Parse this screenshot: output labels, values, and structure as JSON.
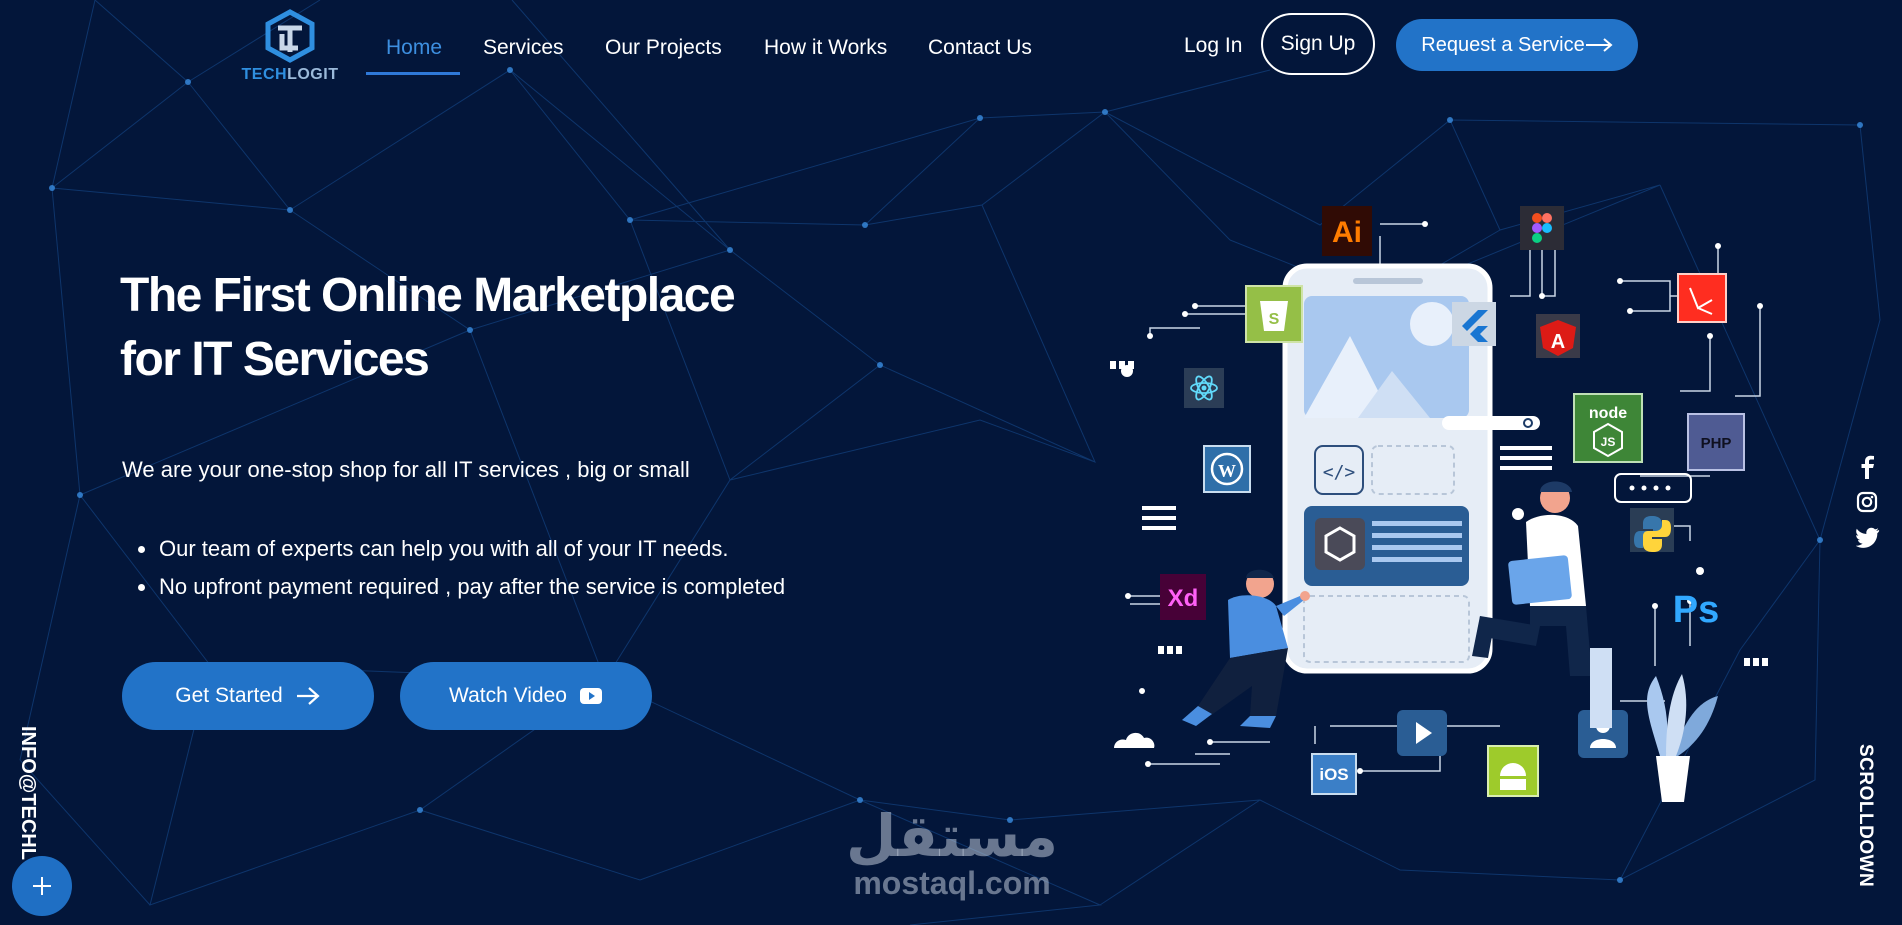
{
  "brand": {
    "logo_text_a": "TECH",
    "logo_text_b": "LOGIT"
  },
  "nav": {
    "links": [
      {
        "label": "Home",
        "active": true
      },
      {
        "label": "Services",
        "active": false
      },
      {
        "label": "Our Projects",
        "active": false
      },
      {
        "label": "How it Works",
        "active": false
      },
      {
        "label": "Contact Us",
        "active": false
      }
    ],
    "login_label": "Log In",
    "signup_label": "Sign Up",
    "request_label": "Request a Service"
  },
  "hero": {
    "title_line1": "The First Online Marketplace",
    "title_line2": "for IT Services",
    "subtitle": "We are your one-stop shop for all IT services , big or small",
    "bullets": [
      "Our team of experts can help you with all of your IT needs.",
      "No upfront payment required , pay after the service is completed"
    ],
    "get_started_label": "Get Started",
    "watch_video_label": "Watch Video"
  },
  "sidebar": {
    "email_text": "INFO@TECHLO",
    "scroll_text": "SCROLLDOWN",
    "social_icons": [
      "facebook-icon",
      "instagram-icon",
      "twitter-icon"
    ]
  },
  "illustration": {
    "badges": [
      "Ai",
      "Xd",
      "Ps",
      "PHP",
      "iOS",
      "node JS"
    ]
  },
  "watermark": {
    "arabic": "مستقل",
    "latin": "mostaql.com"
  },
  "colors": {
    "background": "#03163a",
    "accent": "#2273c8",
    "active_link": "#3d8fe0"
  }
}
